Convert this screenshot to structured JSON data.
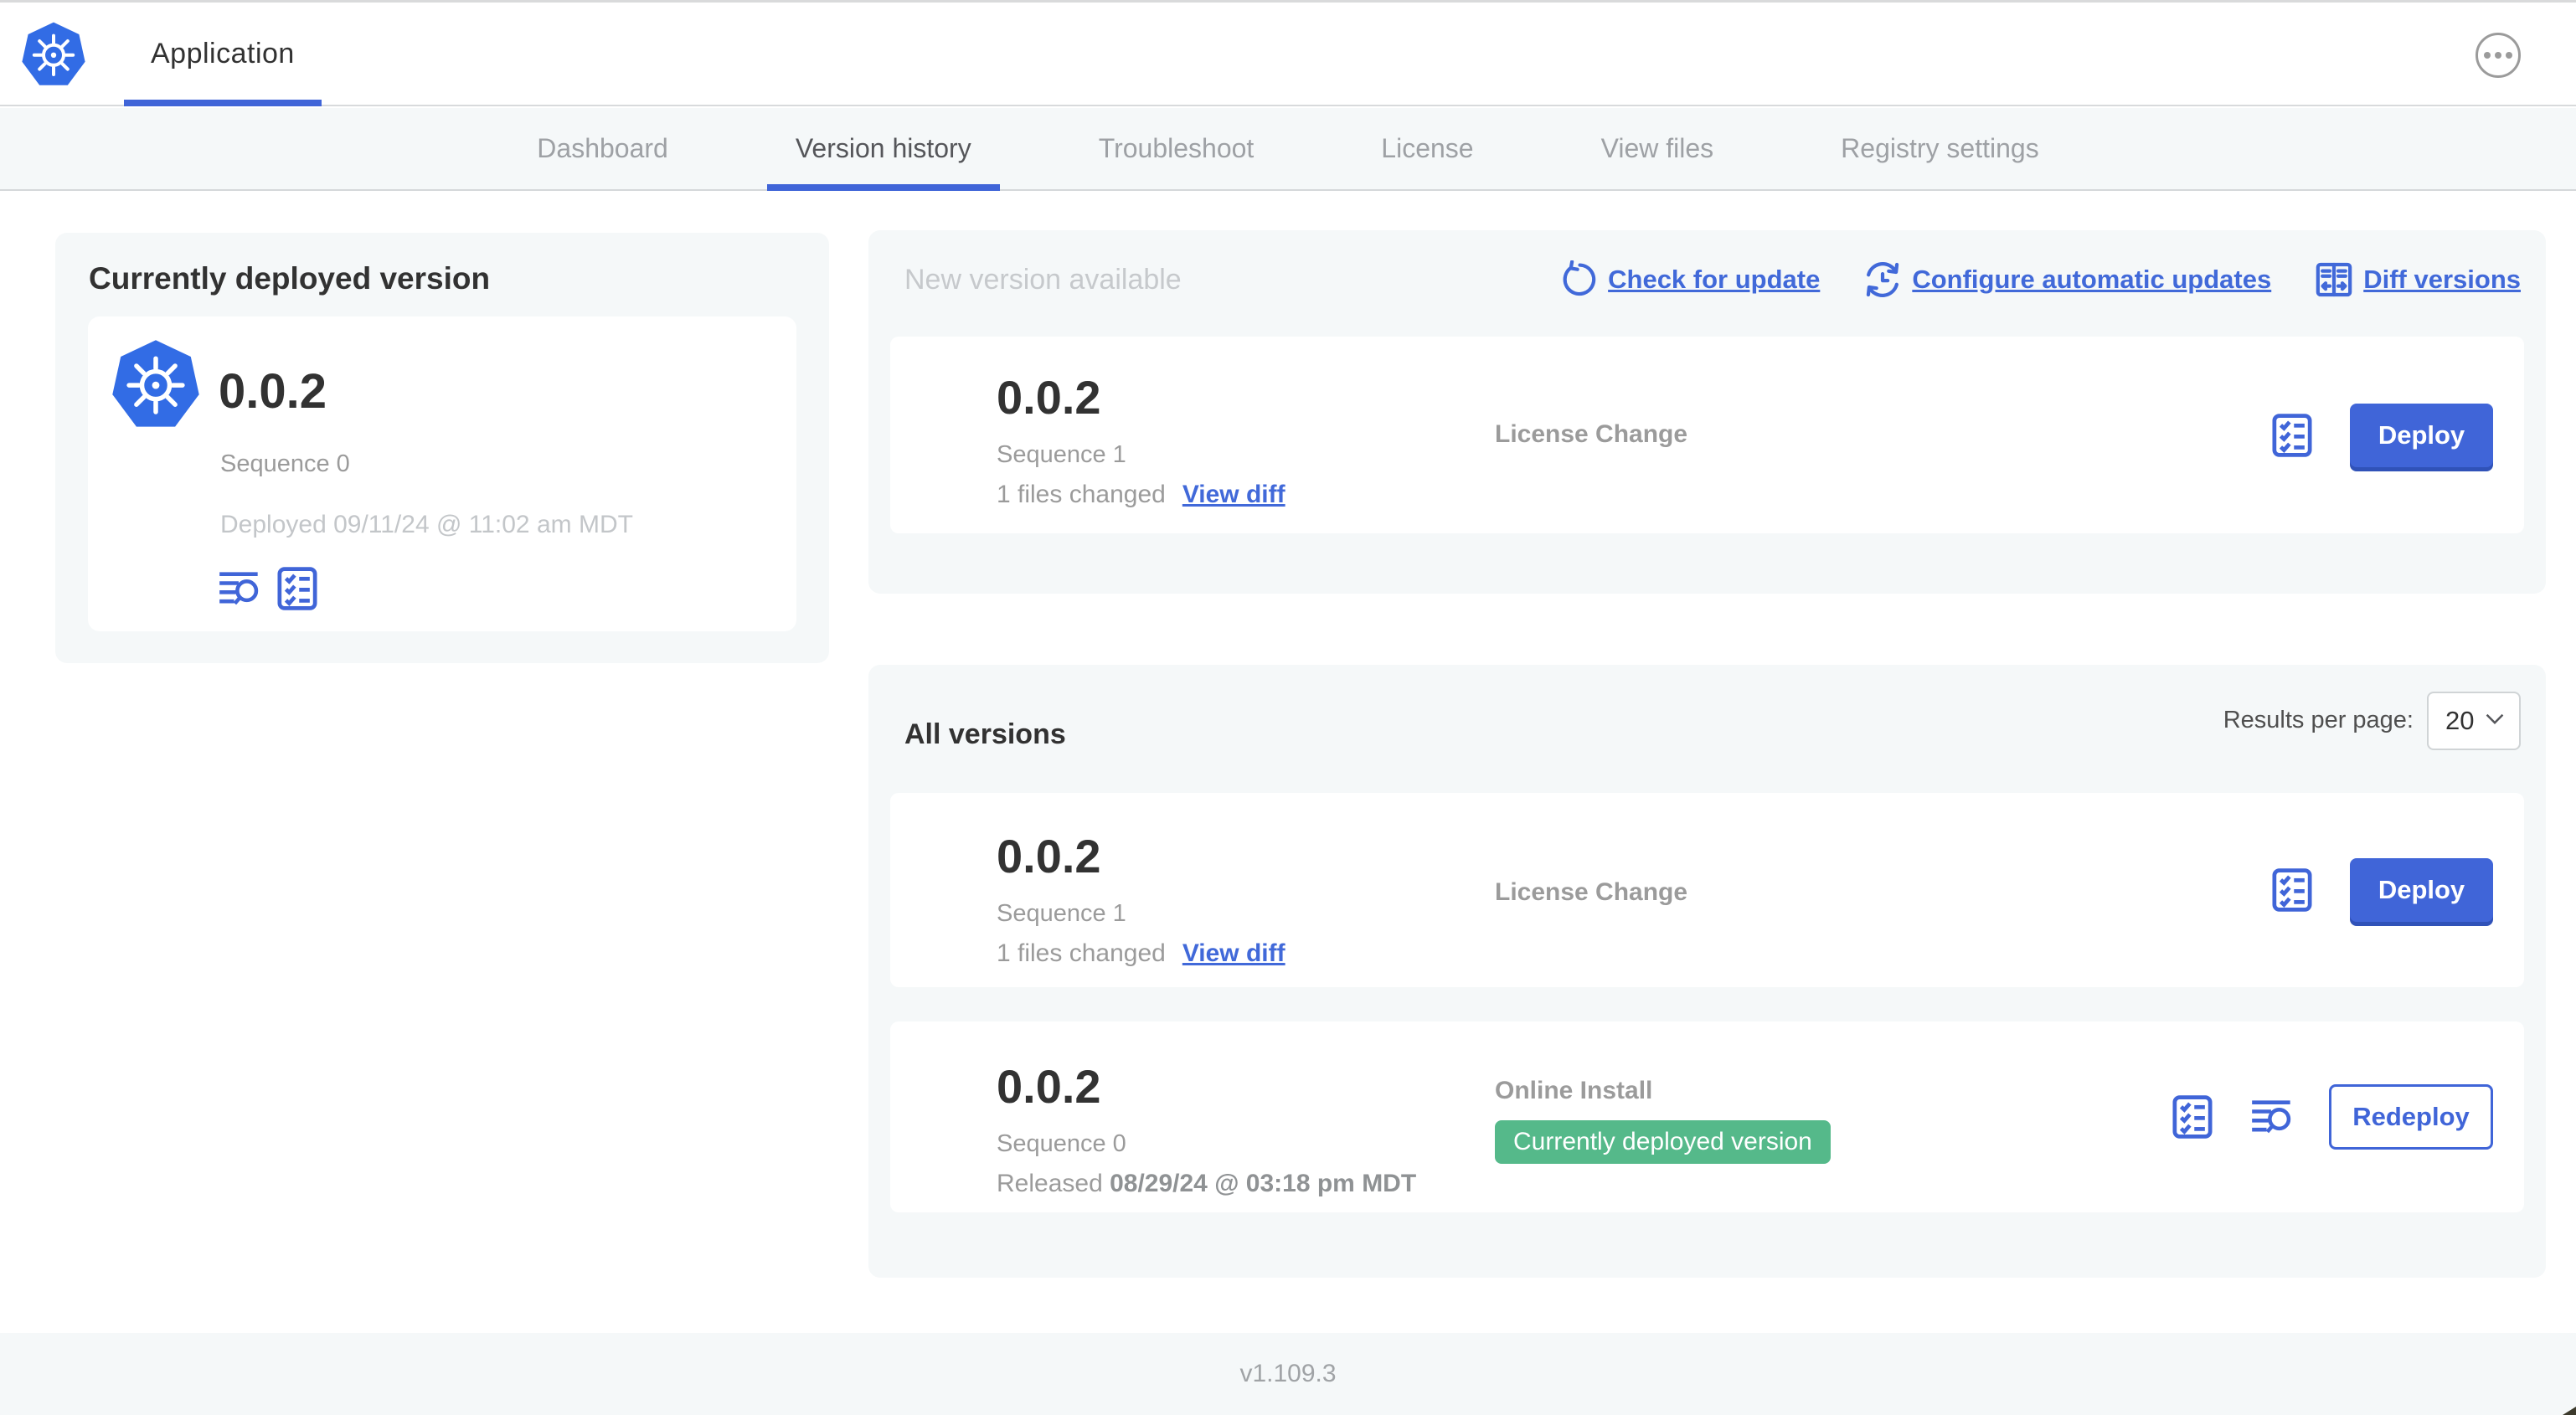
{
  "colors": {
    "accent": "#4065d8",
    "link": "#4169d9",
    "green_badge": "#55b98a",
    "k8s_blue": "#326ce5",
    "panel_bg": "#f5f8f9"
  },
  "header": {
    "app_tab": "Application",
    "logo_icon": "kubernetes-logo",
    "more_icon": "ellipsis-circle-icon"
  },
  "nav": {
    "tabs": [
      {
        "label": "Dashboard",
        "active": false
      },
      {
        "label": "Version history",
        "active": true
      },
      {
        "label": "Troubleshoot",
        "active": false
      },
      {
        "label": "License",
        "active": false
      },
      {
        "label": "View files",
        "active": false
      },
      {
        "label": "Registry settings",
        "active": false
      }
    ]
  },
  "current_version": {
    "title": "Currently deployed version",
    "version": "0.0.2",
    "sequence": "Sequence 0",
    "deployed": "Deployed 09/11/24 @ 11:02 am MDT",
    "icons": [
      "logs-icon",
      "checklist-icon"
    ]
  },
  "new_version": {
    "title": "New version available",
    "actions": [
      {
        "label": "Check for update",
        "icon": "refresh-icon"
      },
      {
        "label": "Configure automatic updates",
        "icon": "schedule-icon"
      },
      {
        "label": "Diff versions",
        "icon": "diff-icon"
      }
    ],
    "card": {
      "version": "0.0.2",
      "sequence": "Sequence 1",
      "files_changed": "1 files changed",
      "view_diff": "View diff",
      "source": "License Change",
      "deploy_label": "Deploy"
    }
  },
  "all_versions": {
    "title": "All versions",
    "results_per_page_label": "Results per page:",
    "results_per_page_value": "20",
    "rows": [
      {
        "version": "0.0.2",
        "sequence": "Sequence 1",
        "files_changed": "1 files changed",
        "view_diff": "View diff",
        "source": "License Change",
        "action_label": "Deploy"
      },
      {
        "version": "0.0.2",
        "sequence": "Sequence 0",
        "released_prefix": "Released ",
        "released_date": "08/29/24 @ 03:18 pm MDT",
        "source": "Online Install",
        "badge": "Currently deployed version",
        "action_label": "Redeploy"
      }
    ]
  },
  "footer": {
    "version": "v1.109.3"
  }
}
